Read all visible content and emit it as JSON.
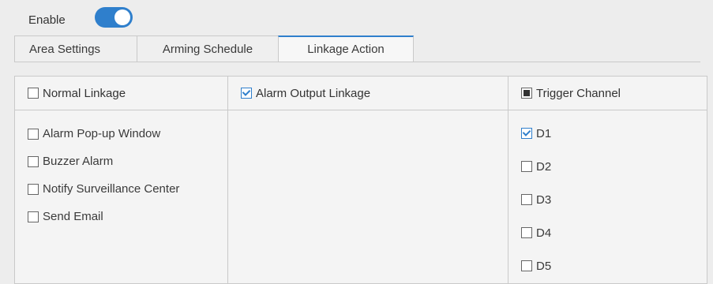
{
  "enable": {
    "label": "Enable",
    "on": true
  },
  "tabs": [
    {
      "label": "Area Settings",
      "active": false
    },
    {
      "label": "Arming Schedule",
      "active": false
    },
    {
      "label": "Linkage Action",
      "active": true
    }
  ],
  "columns": {
    "normal": {
      "header": "Normal Linkage",
      "header_state": "unchecked",
      "items": [
        {
          "label": "Alarm Pop-up Window",
          "checked": false
        },
        {
          "label": "Buzzer Alarm",
          "checked": false
        },
        {
          "label": "Notify Surveillance Center",
          "checked": false
        },
        {
          "label": "Send Email",
          "checked": false
        }
      ]
    },
    "alarm_output": {
      "header": "Alarm Output Linkage",
      "header_state": "checked"
    },
    "trigger": {
      "header": "Trigger Channel",
      "header_state": "partial",
      "items": [
        {
          "label": "D1",
          "checked": true
        },
        {
          "label": "D2",
          "checked": false
        },
        {
          "label": "D3",
          "checked": false
        },
        {
          "label": "D4",
          "checked": false
        },
        {
          "label": "D5",
          "checked": false
        }
      ]
    }
  },
  "colors": {
    "accent": "#2f7fcc",
    "background": "#ededed",
    "border": "#c9c9c9"
  }
}
